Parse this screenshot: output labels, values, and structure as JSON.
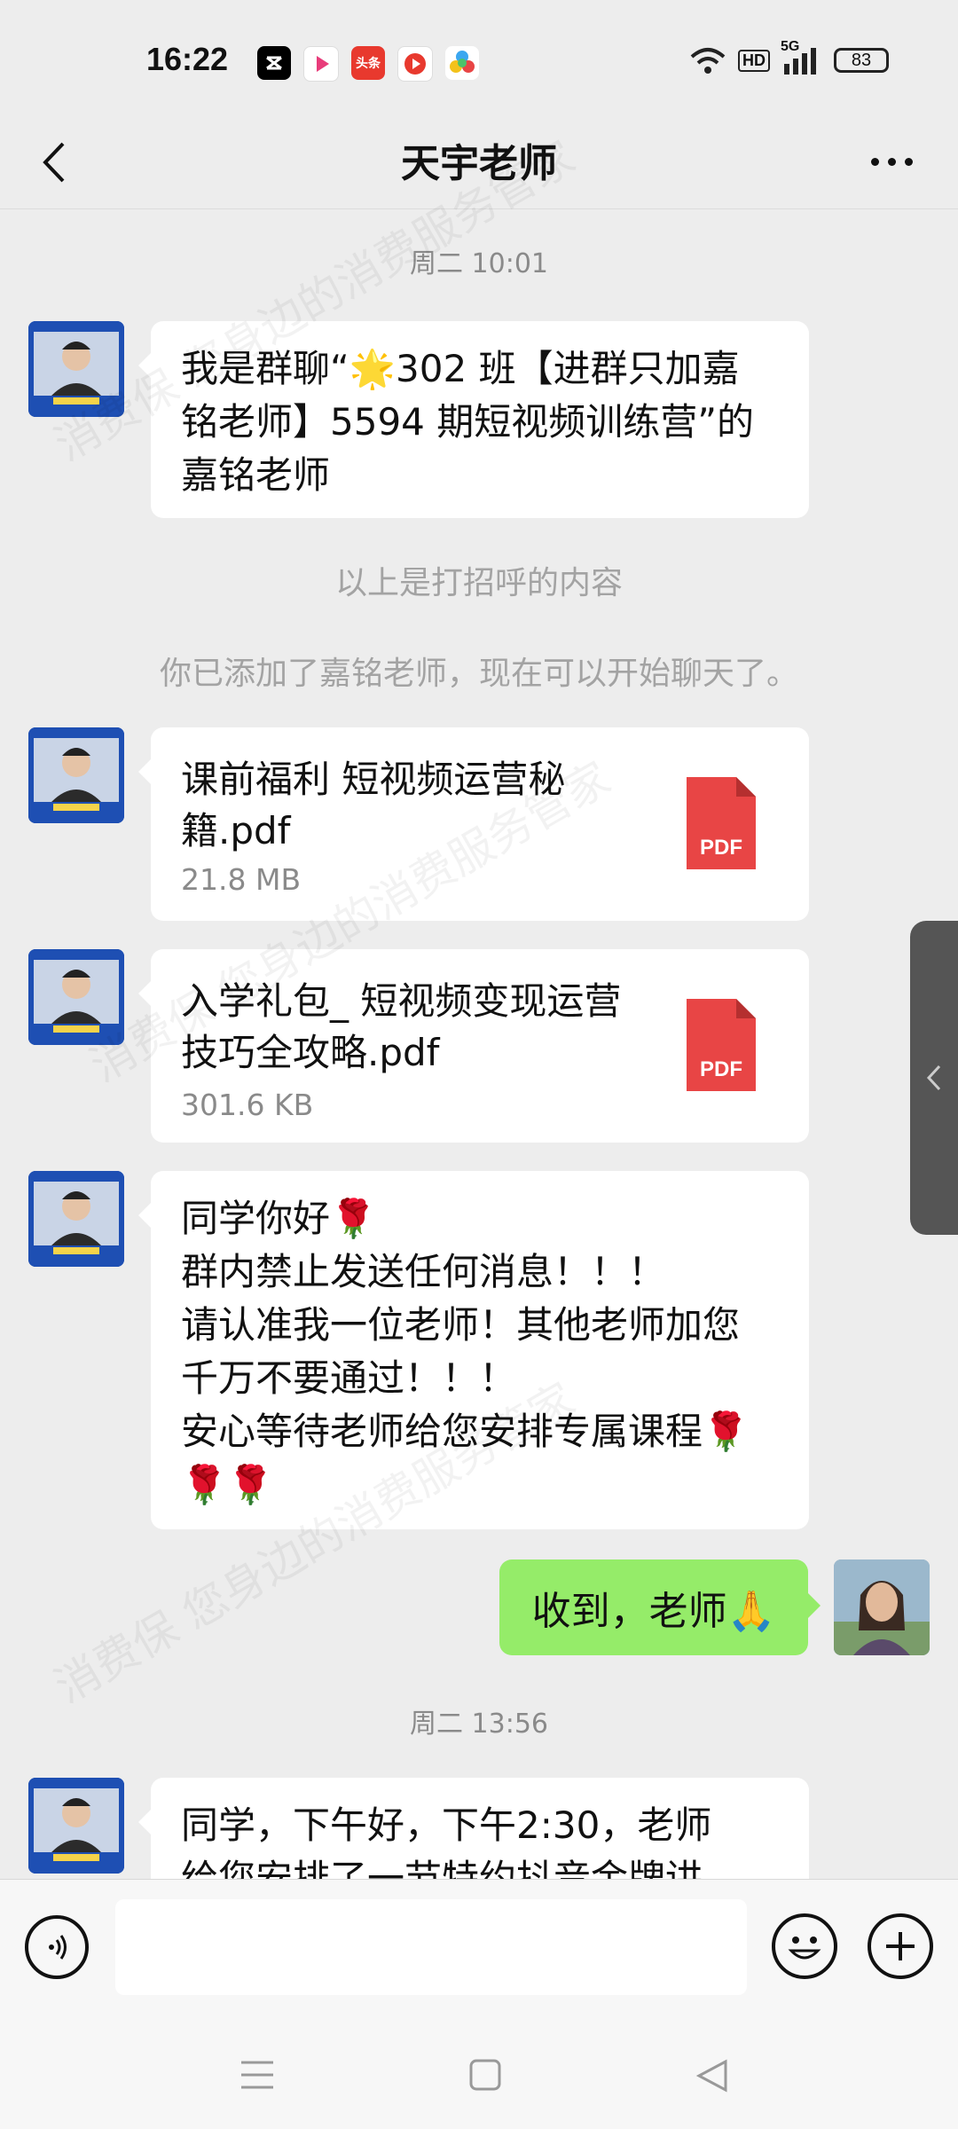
{
  "status_bar": {
    "time": "16:22",
    "apps": [
      {
        "icon": "capcut-icon",
        "color": "#000000",
        "label": ""
      },
      {
        "icon": "video-app-icon",
        "color": "#ffffff",
        "label": ""
      },
      {
        "icon": "toutiao-icon",
        "color": "#e8392e",
        "label": "头条"
      },
      {
        "icon": "red-video-app-icon",
        "color": "#e8392e",
        "label": ""
      },
      {
        "icon": "colorful-app-icon",
        "color": "#ffffff",
        "label": ""
      }
    ],
    "network": "5G",
    "hd_label": "HD",
    "battery": "83"
  },
  "header": {
    "title": "天宇老师"
  },
  "messages": {
    "timestamp1": "周二 10:01",
    "greeting": {
      "lines": [
        "我是群聊“🌟302 班【进群只加嘉",
        "铭老师】5594 期短视频训练营”的",
        "嘉铭老师"
      ]
    },
    "system1": "以上是打招呼的内容",
    "system2": "你已添加了嘉铭老师，现在可以开始聊天了。",
    "file1": {
      "name": "课前福利 短视频运营秘籍.pdf",
      "size": "21.8 MB",
      "icon_label": "PDF"
    },
    "file2": {
      "name": "入学礼包_ 短视频变现运营技巧全攻略.pdf",
      "size": "301.6 KB",
      "icon_label": "PDF"
    },
    "notice": {
      "lines": [
        "同学你好🌹",
        "群内禁止发送任何消息！！！",
        "请认准我一位老师！其他老师加您",
        "千万不要通过！！！",
        "安心等待老师给您安排专属课程🌹",
        "🌹🌹"
      ]
    },
    "sent_reply": "收到，老师🙏",
    "timestamp2": "周二 13:56",
    "afternoon": {
      "lines": [
        "同学，下午好，下午2:30，老师",
        "给您安排了一节特约抖音金牌讲"
      ]
    }
  },
  "watermark": "消费保 您身边的消费服务管家",
  "colors": {
    "background": "#ededed",
    "sent_bubble": "#95ec69",
    "pdf_red": "#e84545"
  }
}
